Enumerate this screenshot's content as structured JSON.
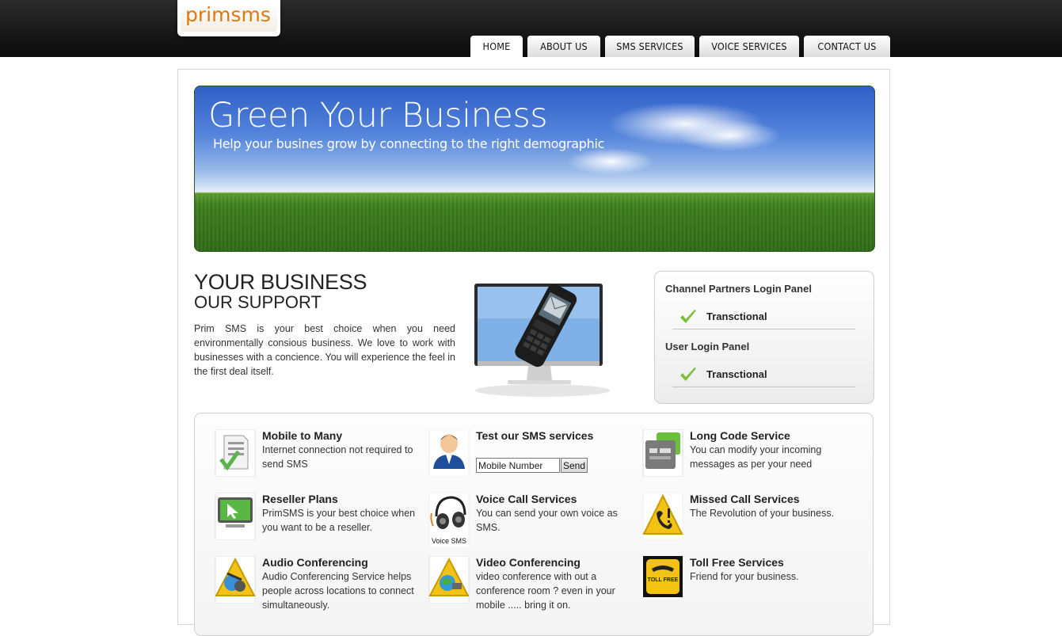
{
  "header": {
    "logo_text": "primsms",
    "nav": [
      {
        "label": "HOME",
        "active": true
      },
      {
        "label": "ABOUT US",
        "active": false
      },
      {
        "label": "SMS SERVICES",
        "active": false
      },
      {
        "label": "VOICE SERVICES",
        "active": false
      },
      {
        "label": "CONTACT US",
        "active": false
      }
    ]
  },
  "banner": {
    "title": "Green Your Business",
    "subtitle": "Help your busines grow by connecting to the right demographic"
  },
  "intro": {
    "title_line1": "YOUR BUSINESS",
    "title_line2": "OUR SUPPORT",
    "text": "Prim SMS is your best choice when you need environmentally consious business. We love to work with businesses with a concience. You will experience the feel in the first deal itself."
  },
  "login_panel": {
    "channel_title": "Channel Partners Login Panel",
    "channel_item": "Transctional",
    "user_title": "User Login Panel",
    "user_item": "Transctional"
  },
  "services": [
    {
      "title": "Mobile to Many",
      "desc": "Internet connection not required to send SMS",
      "icon": "document-check-icon"
    },
    {
      "title": "Test our SMS services",
      "desc": "",
      "icon": "support-agent-icon"
    },
    {
      "title": "Long Code Service",
      "desc": "You can modify your incoming messages as per your need",
      "icon": "long-code-icon"
    },
    {
      "title": "Reseller Plans",
      "desc": "PrimSMS is your best choice when you want to be a reseller.",
      "icon": "monitor-cursor-icon"
    },
    {
      "title": "Voice Call Services",
      "desc": "You can send your own voice as SMS.",
      "icon": "headphones-icon",
      "icon_caption": "Voice SMS"
    },
    {
      "title": "Missed Call Services",
      "desc": "The Revolution of your business.",
      "icon": "missed-call-warning-icon"
    },
    {
      "title": "Audio Conferencing",
      "desc": "Audio Conferencing Service helps people across locations to connect simultaneously.",
      "icon": "audio-conference-icon"
    },
    {
      "title": "Video Conferencing",
      "desc": "video conference with out a conference room ? even in your mobile ..... bring it on.",
      "icon": "video-conference-icon"
    },
    {
      "title": "Toll Free Services",
      "desc": "Friend for your business.",
      "icon": "toll-free-icon",
      "icon_caption": "TOLL FREE"
    }
  ],
  "test_form": {
    "mobile_value": "Mobile Number",
    "send_label": "Send"
  }
}
